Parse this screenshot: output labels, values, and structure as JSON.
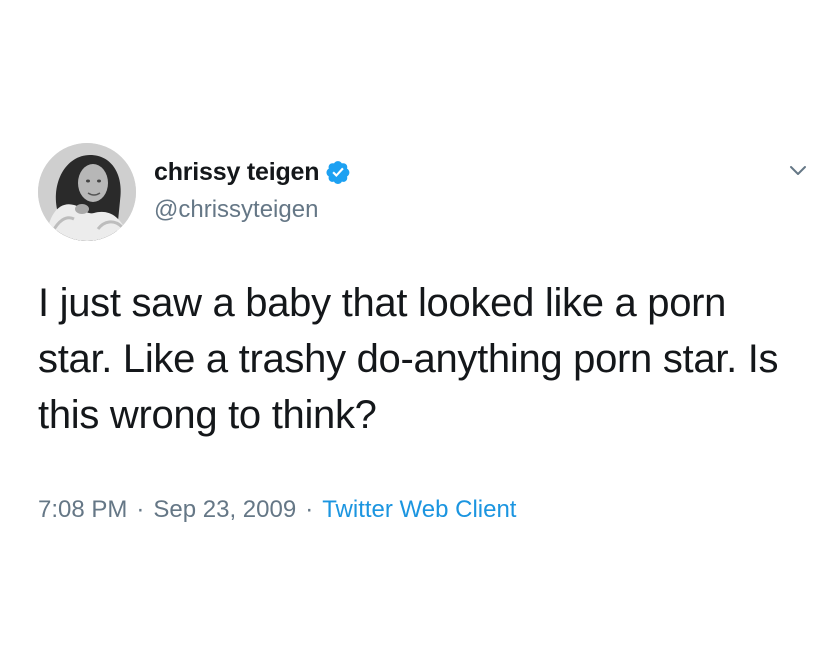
{
  "author": {
    "display_name": "chrissy teigen",
    "handle": "@chrissyteigen",
    "verified": true
  },
  "tweet": {
    "text": "I just saw a baby that looked like a porn star. Like a trashy do-anything porn star. Is this wrong to think?",
    "time": "7:08 PM",
    "date": "Sep 23, 2009",
    "source": "Twitter Web Client",
    "separator": "·"
  },
  "icons": {
    "verified": "verified-badge-icon",
    "menu": "chevron-down-icon"
  },
  "colors": {
    "text": "#14171a",
    "muted": "#657786",
    "link": "#1b95e0",
    "verified": "#1da1f2"
  }
}
